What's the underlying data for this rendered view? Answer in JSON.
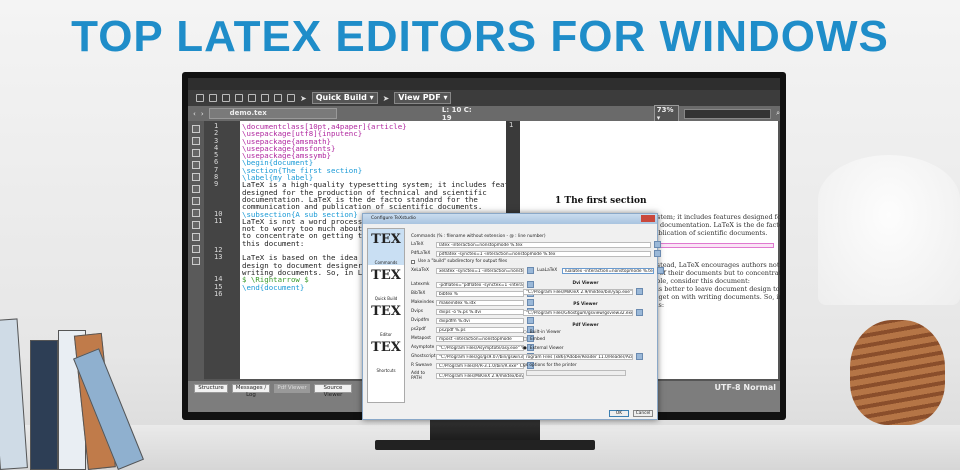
{
  "headline": "TOP LATEX EDITORS FOR WINDOWS",
  "toolbar": {
    "quick_build": "Quick Build ▾",
    "view_pdf": "View PDF ▾"
  },
  "tabbar": {
    "file": "demo.tex",
    "position": "L: 10 C: 19",
    "zoom": "73% ▾"
  },
  "editor": {
    "lines": [
      {
        "n": "1",
        "t": "\\documentclass[10pt,a4paper]{article}",
        "c": "cmd"
      },
      {
        "n": "2",
        "t": "\\usepackage[utf8]{inputenc}",
        "c": "cmd"
      },
      {
        "n": "3",
        "t": "\\usepackage{amsmath}",
        "c": "cmd"
      },
      {
        "n": "4",
        "t": "\\usepackage{amsfonts}",
        "c": "cmd"
      },
      {
        "n": "5",
        "t": "\\usepackage{amssymb}",
        "c": "cmd"
      },
      {
        "n": "6",
        "t": "\\begin{document}",
        "c": "sec"
      },
      {
        "n": "7",
        "t": "\\section{The first section}",
        "c": "sec"
      },
      {
        "n": "8",
        "t": "\\label{my label}",
        "c": "sec"
      },
      {
        "n": "9",
        "t": "LaTeX is a high-quality typesetting system; it includes features",
        "c": ""
      },
      {
        "n": "",
        "t": "designed for the production of technical and scientific",
        "c": ""
      },
      {
        "n": "",
        "t": "documentation. LaTeX is the de facto standard for the",
        "c": ""
      },
      {
        "n": "",
        "t": "communication and publication of scientific documents.",
        "c": ""
      },
      {
        "n": "10",
        "t": "\\subsection{A sub section}",
        "c": "sec"
      },
      {
        "n": "11",
        "t": "LaTeX is not a word processor! Instead, LaTeX encourages",
        "c": ""
      },
      {
        "n": "",
        "t": "not to worry too much about the appearance",
        "c": ""
      },
      {
        "n": "",
        "t": "to concentrate on getting the right content.",
        "c": ""
      },
      {
        "n": "",
        "t": "this document:",
        "c": ""
      },
      {
        "n": "12",
        "t": "",
        "c": ""
      },
      {
        "n": "13",
        "t": "LaTeX is based on the idea that it is better to leave document",
        "c": ""
      },
      {
        "n": "",
        "t": "design to document designers, and to let authors get on with",
        "c": ""
      },
      {
        "n": "",
        "t": "writing documents. So, in LaTeX you would input this as:",
        "c": ""
      },
      {
        "n": "14",
        "t": "$ \\Rightarrow $",
        "c": "math"
      },
      {
        "n": "15",
        "t": "\\end{document}",
        "c": "sec"
      },
      {
        "n": "16",
        "t": "",
        "c": ""
      }
    ]
  },
  "pdf": {
    "heading": "1   The first section",
    "para1": "system; it includes features designed for\nfic documentation. LaTeX is the de facto\npublication of scientific documents.",
    "para2": "Instead, LaTeX encourages authors not to\nce of their documents but to concentrate\nmple, consider this document:\nit is better to leave document design to\nrs get on with writing documents. So, in\nt as:"
  },
  "bottom_tabs": [
    "Structure",
    "Messages / Log",
    "Pdf Viewer",
    "Source Viewer"
  ],
  "status": "UTF-8   Normal",
  "dialog": {
    "title": "Configure TeXstudio",
    "sidebar": [
      "Commands",
      "Quick Build",
      "Editor",
      "Shortcuts"
    ],
    "header": "Commands (% : filename without extension - @ : line number)",
    "top_rows": [
      {
        "label": "LaTeX",
        "value": "latex -interaction=nonstopmode %.tex"
      },
      {
        "label": "PdfLaTeX",
        "value": "pdflatex -synctex=1 -interaction=nonstopmode %.tex"
      }
    ],
    "checkbox": "Use a \"build\" subdirectory for output files",
    "xelatex": {
      "label": "XeLaTeX",
      "value": "xelatex -synctex=1 -interaction=nonstopmode %.tex"
    },
    "lualatex": {
      "label": "LuaLaTeX",
      "value": "lualatex -interaction=nonstopmode %.tex"
    },
    "rows": [
      {
        "label": "Latexmk",
        "value": "-pdflatex=\"pdflatex -synctex=1 -interaction=nonstopmode\" -pdf %.tex"
      },
      {
        "label": "BibTeX",
        "value": "bibtex %"
      },
      {
        "label": "Makeindex",
        "value": "makeindex %.idx"
      },
      {
        "label": "Dvips",
        "value": "dvips -o %.ps %.dvi"
      },
      {
        "label": "Dvipdfm",
        "value": "dvipdfm %.dvi"
      },
      {
        "label": "ps2pdf",
        "value": "ps2pdf %.ps"
      },
      {
        "label": "Metapost",
        "value": "mpost -interaction=nonstopmode"
      },
      {
        "label": "Asymptote",
        "value": "\"C:/Program Files/Asymptote/asy.exe\" %.asy"
      },
      {
        "label": "Ghostscript",
        "value": "\"C:/Program Files/gs/gs9.07/bin/gswin32c.exe\""
      },
      {
        "label": "R Sweave",
        "value": "C:/Program Files/R/R-3.1.0/bin/R.exe\" CMD Sweave %.Rnw"
      }
    ],
    "path": {
      "label": "Add to PATH",
      "value": "C:/Program Files/MiKTeX 2.9/miktex/bin/;etc"
    },
    "dvi_viewer": {
      "label": "Dvi Viewer",
      "value": "\"C:/Program Files/MiKTeX 2.9/miktex/bin/yap.exe\" %.dvi"
    },
    "ps_viewer": {
      "label": "PS Viewer",
      "value": "\"C:/Program Files/Ghostgum/gsview/gsview32.exe\" %.ps"
    },
    "pdf_viewer": {
      "label": "Pdf Viewer",
      "builtin": "Built-in Viewer",
      "embed": "Embed",
      "external": "External Viewer",
      "value": "rogram Files (x86)/Adobe/Reader 11.0/Reader/AcroRd32.exe\" %.pdf",
      "printer": "gs options for the printer"
    },
    "ok": "OK",
    "cancel": "Cancel"
  }
}
